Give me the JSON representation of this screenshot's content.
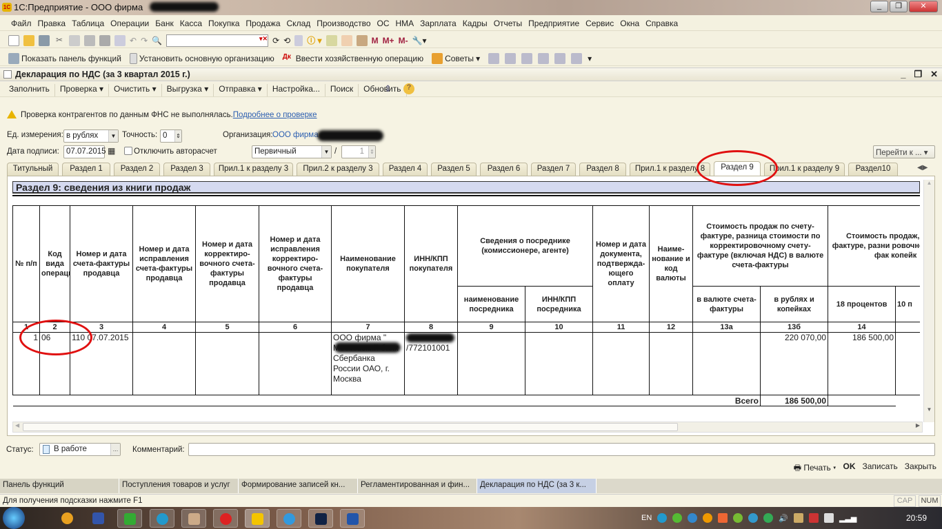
{
  "window": {
    "title": "1С:Предприятие - ООО фирма",
    "logo": "1С"
  },
  "menu": [
    "Файл",
    "Правка",
    "Таблица",
    "Операции",
    "Банк",
    "Касса",
    "Покупка",
    "Продажа",
    "Склад",
    "Производство",
    "ОС",
    "НМА",
    "Зарплата",
    "Кадры",
    "Отчеты",
    "Предприятие",
    "Сервис",
    "Окна",
    "Справка"
  ],
  "toolbar1": {
    "search_value": "",
    "m": "M",
    "mplus": "M+",
    "mminus": "M-"
  },
  "toolbar2": [
    "Показать панель функций",
    "Установить основную организацию",
    "Ввести хозяйственную операцию",
    "Советы"
  ],
  "document": {
    "title": "Декларация по НДС (за 3 квартал 2015 г.)",
    "actions": [
      "Заполнить",
      "Проверка ▾",
      "Очистить ▾",
      "Выгрузка ▾",
      "Отправка ▾",
      "Настройка...",
      "Поиск",
      "Обновить"
    ],
    "warning": "Проверка контрагентов по данным ФНС не выполнялась.",
    "warning_link": "Подробнее о проверке",
    "unit_label": "Ед. измерения:",
    "unit_value": "в рублях",
    "precision_label": "Точность:",
    "precision_value": "0",
    "org_label": "Организация:",
    "org_value": "ООО фирма",
    "date_label": "Дата подписи:",
    "date_value": "07.07.2015",
    "autocalc_label": "Отключить авторасчет",
    "autocalc_checked": false,
    "type_value": "Первичный",
    "slash": "/",
    "correction_number": "1",
    "goto_label": "Перейти к ...",
    "tabs": [
      "Титульный",
      "Раздел 1",
      "Раздел 2",
      "Раздел 3",
      "Прил.1 к разделу 3",
      "Прил.2 к разделу 3",
      "Раздел 4",
      "Раздел 5",
      "Раздел 6",
      "Раздел 7",
      "Раздел 8",
      "Прил.1 к разделу 8",
      "Раздел 9",
      "Прил.1 к разделу 9",
      "Раздел10"
    ],
    "active_tab": "Раздел 9"
  },
  "section": {
    "title": "Раздел 9: сведения из книги продаж",
    "headers": {
      "c1": "№ п/п",
      "c2": "Код вида операции",
      "c3": "Номер и дата счета-фактуры продавца",
      "c4": "Номер и дата исправления счета-фактуры продавца",
      "c5": "Номер и дата корректиро-вочного счета-фактуры продавца",
      "c6": "Номер и дата исправления корректиро-вочного счета-фактуры продавца",
      "c7": "Наименование покупателя",
      "c8": "ИНН/КПП покупателя",
      "c9_10": "Сведения о посреднике (комиссионере, агенте)",
      "c9": "наименование посредника",
      "c10": "ИНН/КПП посредника",
      "c11": "Номер и дата документа, подтвержда-ющего оплату",
      "c12": "Наиме-нование и код валюты",
      "c13": "Стоимость продаж по счету-фактуре, разница стоимости по корректировочному счету-фактуре (включая НДС) в валюте счета-фактуры",
      "c13a": "в валюте счета-фактуры",
      "c13b": "в рублях и копейках",
      "c14_group": "Стоимость продаж, счету-фактуре, разни ровочному счету-фак копейк",
      "c14": "18 процентов",
      "c15": "10 п"
    },
    "numbers": [
      "1",
      "2",
      "3",
      "4",
      "5",
      "6",
      "7",
      "8",
      "9",
      "10",
      "11",
      "12",
      "13а",
      "13б",
      "14",
      ""
    ],
    "row": {
      "n": "1",
      "code": "06",
      "invoice": "110 07.07.2015",
      "buyer": "ООО фирма \" Московский банк Сбербанка России ОАО, г. Москва",
      "inn": "/772101001",
      "c13b": "220 070,00",
      "c14": "186 500,00"
    },
    "total_label": "Всего",
    "total_c14": "186 500,00"
  },
  "status": {
    "label": "Статус:",
    "value": "В работе",
    "comment_label": "Комментарий:",
    "comment_value": ""
  },
  "bottom_actions": [
    "Печать ▾",
    "OK",
    "Записать",
    "Закрыть"
  ],
  "window_tabs": [
    "Панель функций",
    "Поступления товаров и услуг",
    "Формирование записей кн...",
    "Регламентированная и фин...",
    "Декларация по НДС (за 3 к..."
  ],
  "hint": "Для получения подсказки нажмите F1",
  "cap": "CAP",
  "num": "NUM",
  "taskbar": {
    "lang": "EN",
    "clock": "20:59"
  }
}
